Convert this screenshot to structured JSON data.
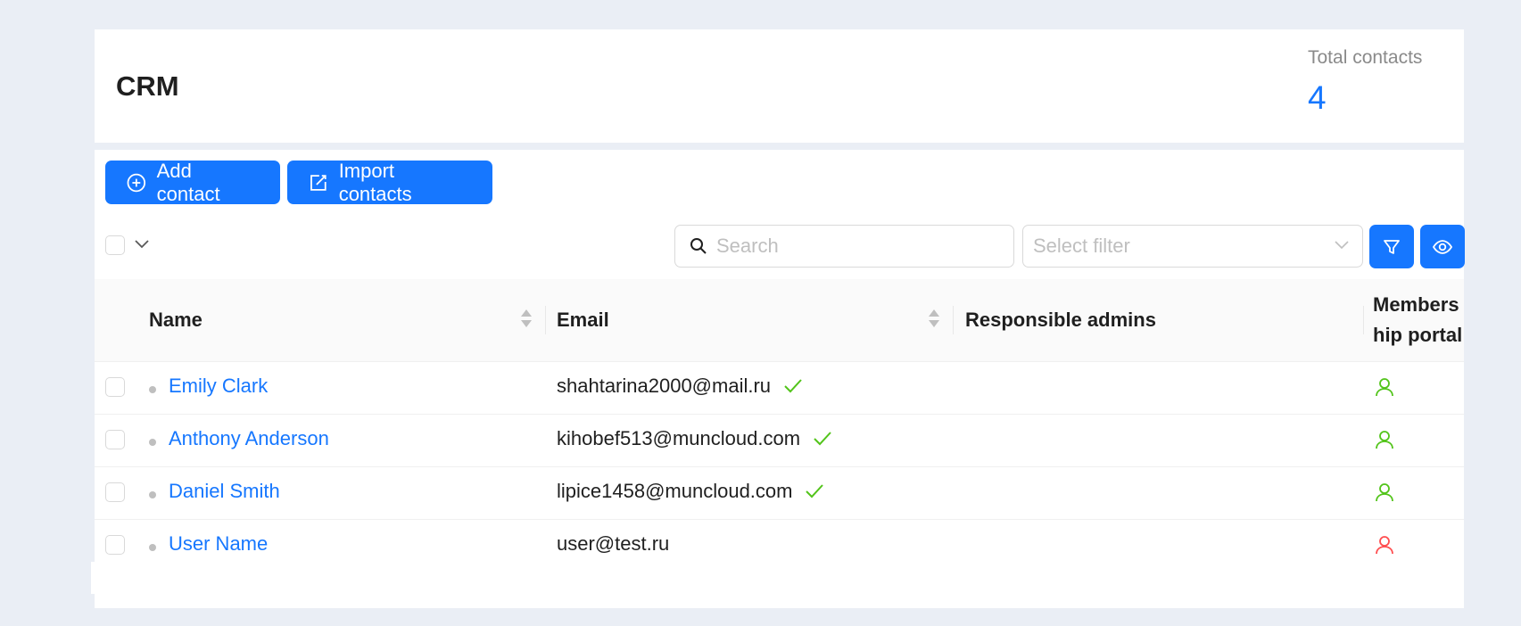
{
  "header": {
    "title": "CRM",
    "stat_label": "Total contacts",
    "stat_value": "4"
  },
  "toolbar": {
    "add_label": "Add contact",
    "import_label": "Import contacts",
    "search_placeholder": "Search",
    "filter_placeholder": "Select filter"
  },
  "table": {
    "columns": {
      "name": "Name",
      "email": "Email",
      "admins": "Responsible admins",
      "portal_line1": "Members",
      "portal_line2": "hip portal"
    },
    "rows": [
      {
        "name": "Emily Clark",
        "email": "shahtarina2000@mail.ru",
        "verified": true,
        "portal_status": "active"
      },
      {
        "name": "Anthony Anderson",
        "email": "kihobef513@muncloud.com",
        "verified": true,
        "portal_status": "active"
      },
      {
        "name": "Daniel Smith",
        "email": "lipice1458@muncloud.com",
        "verified": true,
        "portal_status": "active"
      },
      {
        "name": "User Name",
        "email": "user@test.ru",
        "verified": false,
        "portal_status": "inactive"
      }
    ]
  },
  "colors": {
    "primary": "#1677ff",
    "success": "#52c41a",
    "danger": "#ff4d4f",
    "background": "#eaeef5"
  }
}
